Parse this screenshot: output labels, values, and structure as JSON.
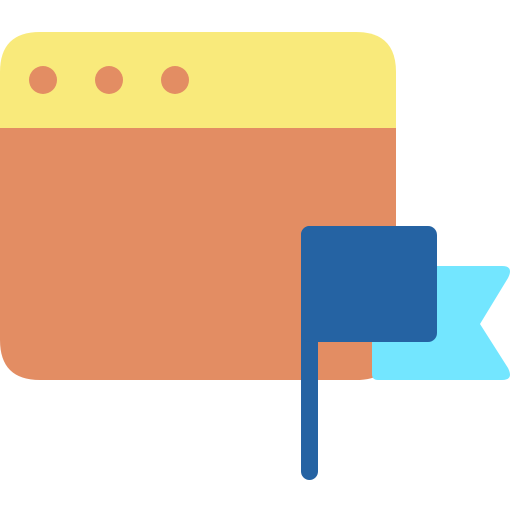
{
  "icon": {
    "name": "browser-window-flag-icon",
    "colors": {
      "window_body": "#E38D63",
      "window_titlebar": "#F9EA7B",
      "window_dots": "#E38D63",
      "flag_main": "#2563A3",
      "flag_ribbon": "#73E6FF"
    }
  }
}
